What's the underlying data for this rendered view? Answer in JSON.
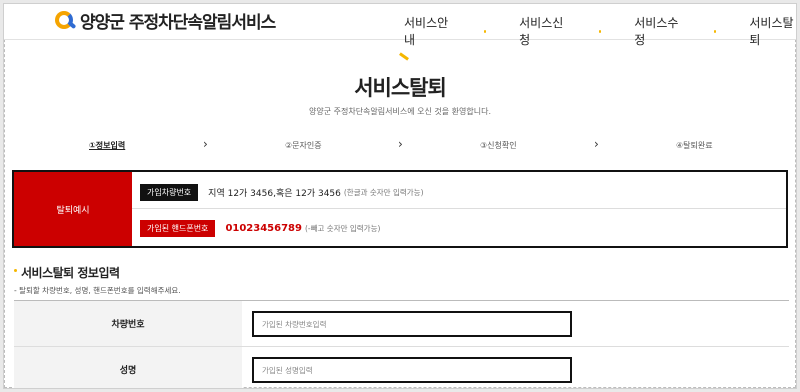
{
  "header": {
    "logo_text": "양양군 주정차단속알림서비스",
    "nav": [
      "서비스안내",
      "서비스신청",
      "서비스수정",
      "서비스탈퇴"
    ]
  },
  "page": {
    "title": "서비스탈퇴",
    "subtitle": "양양군 주정차단속알림서비스에 오신 것을 환영합니다."
  },
  "steps": [
    "①정보입력",
    "②문자인증",
    "③신청확인",
    "④탈퇴완료"
  ],
  "example": {
    "label": "탈퇴예시",
    "rows": [
      {
        "tag": "가입차량번호",
        "value": "지역 12가 3456,혹은 12가 3456",
        "note": "(한글과 숫자만 입력가능)"
      },
      {
        "tag": "가입된 핸드폰번호",
        "value": "01023456789",
        "note": "(-빼고 숫자만 입력가능)"
      }
    ]
  },
  "form": {
    "section_title": "서비스탈퇴 정보입력",
    "hint": "- 탈퇴할 차량번호, 성명, 핸드폰번호를 입력해주세요.",
    "fields": [
      {
        "label": "차량번호",
        "placeholder": "가입된 차량번호입력"
      },
      {
        "label": "성명",
        "placeholder": "가입된 성명입력"
      }
    ]
  },
  "colors": {
    "accent": "#f5b700",
    "brand_red": "#cc0000",
    "logo_blue": "#2f6bd2"
  }
}
